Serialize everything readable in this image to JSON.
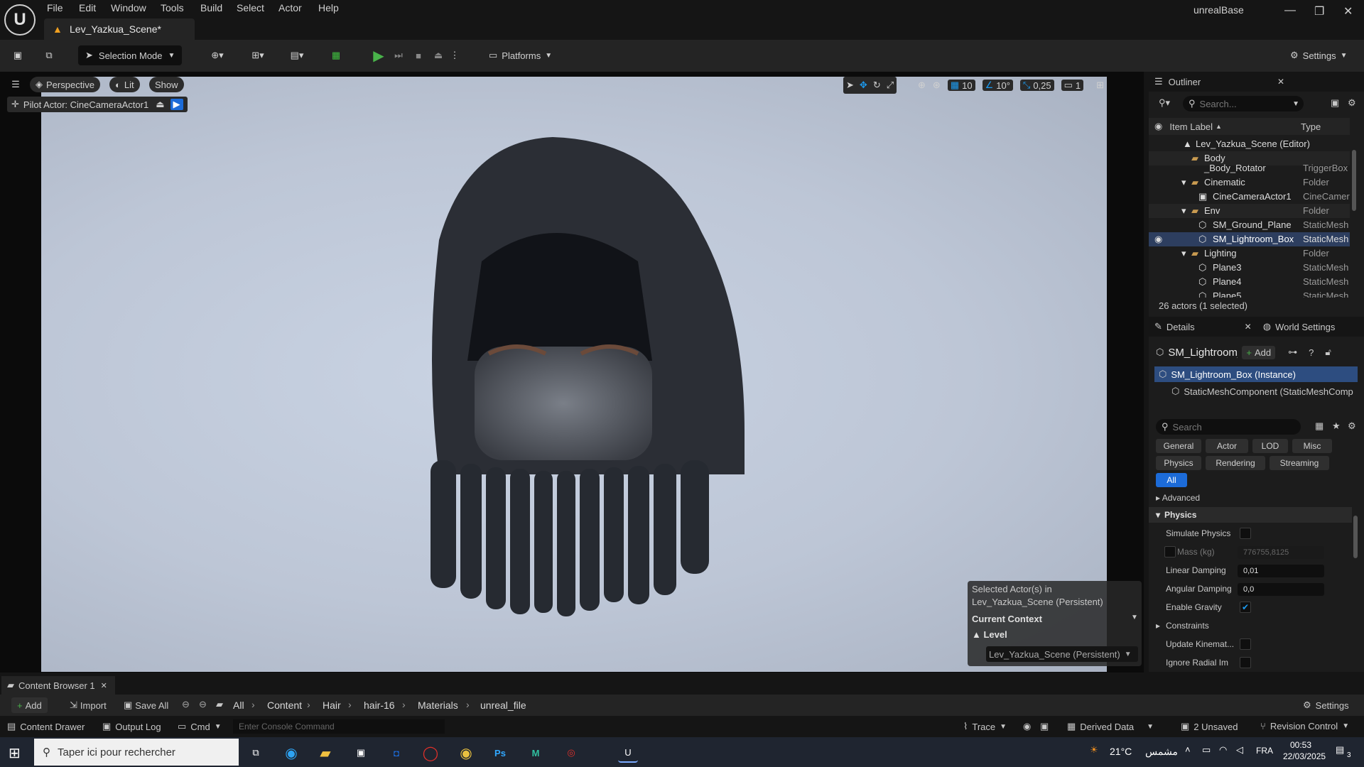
{
  "app": {
    "window_title": "unrealBase",
    "doc_tab": "Lev_Yazkua_Scene*"
  },
  "menu": [
    "File",
    "Edit",
    "Window",
    "Tools",
    "Build",
    "Select",
    "Actor",
    "Help"
  ],
  "toolbar": {
    "mode": "Selection Mode",
    "platforms": "Platforms",
    "settings": "Settings"
  },
  "viewport": {
    "perspective": "Perspective",
    "lit": "Lit",
    "show": "Show",
    "pilot": "Pilot Actor: CineCameraActor1",
    "grid_snap": "10",
    "rot_snap": "10°",
    "scale_snap": "0,25",
    "cam_speed": "1"
  },
  "context": {
    "line1": "Selected Actor(s) in",
    "line2": "Lev_Yazkua_Scene (Persistent)",
    "current_context": "Current Context",
    "level": "Level",
    "level_value": "Lev_Yazkua_Scene (Persistent)"
  },
  "outliner": {
    "title": "Outliner",
    "search_placeholder": "Search...",
    "col_label": "Item Label",
    "col_type": "Type",
    "items": [
      {
        "label": "Lev_Yazkua_Scene (Editor)",
        "type": ""
      },
      {
        "label": "Body",
        "type": ""
      },
      {
        "label": "_Body_Rotator",
        "type": "TriggerBox"
      },
      {
        "label": "Cinematic",
        "type": "Folder"
      },
      {
        "label": "CineCameraActor1",
        "type": "CineCamera"
      },
      {
        "label": "Env",
        "type": "Folder"
      },
      {
        "label": "SM_Ground_Plane",
        "type": "StaticMesh"
      },
      {
        "label": "SM_Lightroom_Box",
        "type": "StaticMesh"
      },
      {
        "label": "Lighting",
        "type": "Folder"
      },
      {
        "label": "Plane3",
        "type": "StaticMesh"
      },
      {
        "label": "Plane4",
        "type": "StaticMesh"
      },
      {
        "label": "Plane5",
        "type": "StaticMesh"
      }
    ],
    "footer": "26 actors (1 selected)"
  },
  "details": {
    "title": "Details",
    "world_settings": "World Settings",
    "actor_name": "SM_Lightroom_Box",
    "add": "Add",
    "instance": "SM_Lightroom_Box (Instance)",
    "component": "StaticMeshComponent (StaticMeshComp",
    "search_placeholder": "Search",
    "filters_row1": [
      "General",
      "Actor",
      "LOD",
      "Misc"
    ],
    "filters_row2": [
      "Physics",
      "Rendering",
      "Streaming"
    ],
    "filter_all": "All",
    "advanced": "Advanced",
    "physics_section": "Physics",
    "props": {
      "simulate_physics": "Simulate Physics",
      "mass": "Mass (kg)",
      "mass_value": "776755,8125",
      "linear_damping": "Linear Damping",
      "linear_damping_value": "0,01",
      "angular_damping": "Angular Damping",
      "angular_damping_value": "0,0",
      "enable_gravity": "Enable Gravity",
      "constraints": "Constraints",
      "update_kinematic": "Update Kinemat...",
      "ignore_radial": "Ignore Radial Im"
    }
  },
  "content_browser": {
    "tab": "Content Browser 1",
    "add": "Add",
    "import": "Import",
    "save_all": "Save All",
    "path": [
      "All",
      "Content",
      "Hair",
      "hair-16",
      "Materials",
      "unreal_file"
    ],
    "settings": "Settings"
  },
  "statusbar": {
    "content_drawer": "Content Drawer",
    "output_log": "Output Log",
    "cmd": "Cmd",
    "console_placeholder": "Enter Console Command",
    "trace": "Trace",
    "derived_data": "Derived Data",
    "unsaved": "2 Unsaved",
    "revision_control": "Revision Control"
  },
  "taskbar": {
    "search_placeholder": "Taper ici pour rechercher",
    "weather": "21°C",
    "weather_desc": "مشمس",
    "lang": "FRA",
    "time": "00:53",
    "date": "22/03/2025",
    "notif_count": "3"
  },
  "colors": {
    "accent": "#1c6bd8",
    "selected_row": "#2d3e5f",
    "play": "#49b24a"
  }
}
